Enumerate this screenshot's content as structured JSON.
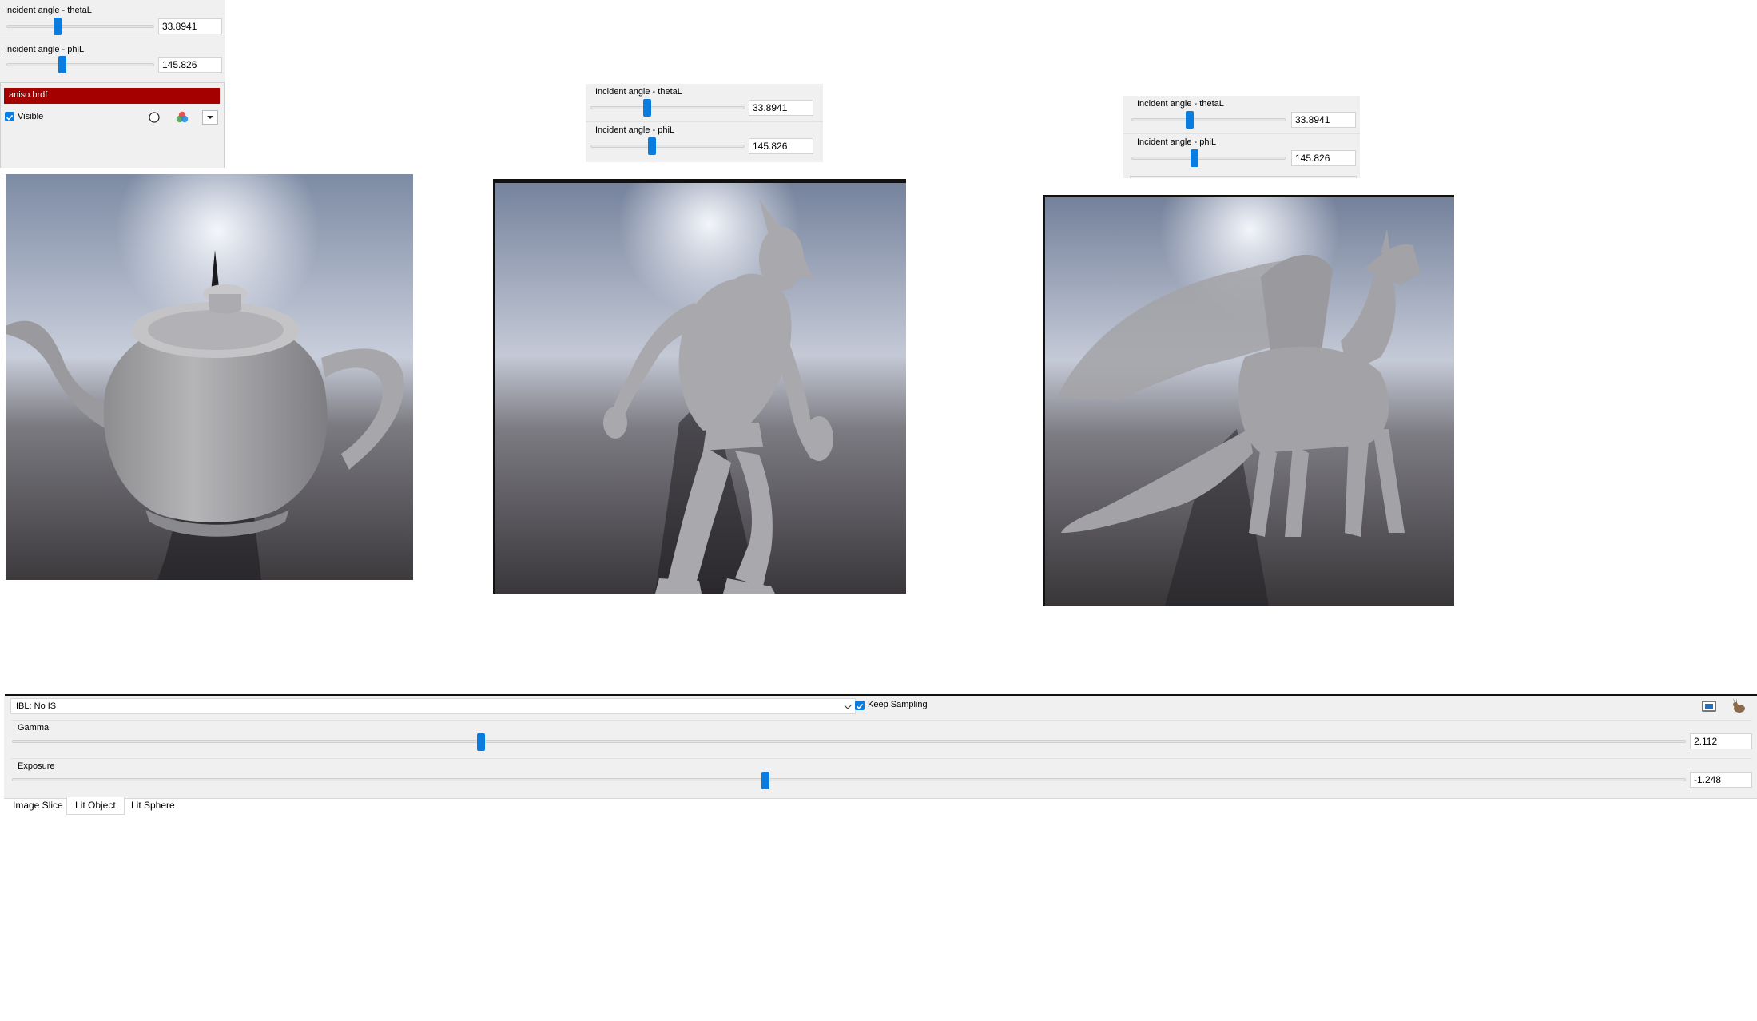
{
  "panel_left": {
    "theta": {
      "label": "Incident angle - thetaL",
      "value": "33.8941"
    },
    "phi": {
      "label": "Incident angle - phiL",
      "value": "145.826"
    },
    "brdf_name": "aniso.brdf",
    "visible_label": "Visible",
    "visible_checked": true
  },
  "panel_mid": {
    "theta": {
      "label": "Incident angle - thetaL",
      "value": "33.8941"
    },
    "phi": {
      "label": "Incident angle - phiL",
      "value": "145.826"
    }
  },
  "panel_right": {
    "theta": {
      "label": "Incident angle - thetaL",
      "value": "33.8941"
    },
    "phi": {
      "label": "Incident angle - phiL",
      "value": "145.826"
    }
  },
  "bottom": {
    "ibl_select": "IBL: No IS",
    "keep_sampling_label": "Keep Sampling",
    "keep_sampling_checked": true,
    "gamma": {
      "label": "Gamma",
      "value": "2.112",
      "fraction": 0.28
    },
    "exposure": {
      "label": "Exposure",
      "value": "-1.248",
      "fraction": 0.45
    }
  },
  "tabs": [
    "Image Slice",
    "Lit Object",
    "Lit Sphere"
  ],
  "active_tab_index": 1,
  "colors": {
    "accent": "#0a7ce0",
    "brdf_bar": "#a50000"
  }
}
